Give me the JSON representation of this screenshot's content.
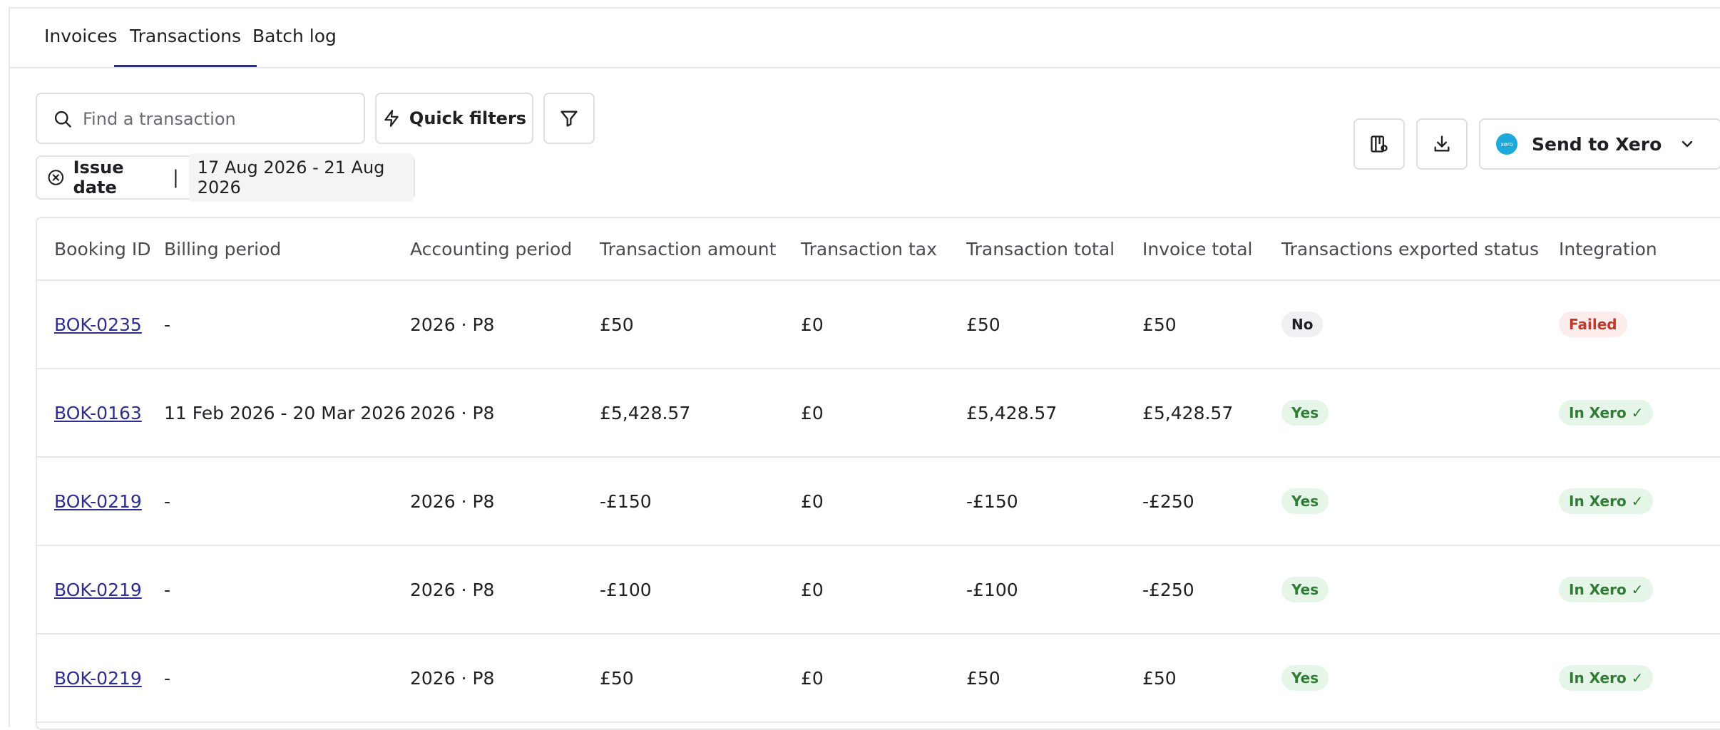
{
  "tabs": [
    {
      "label": "Invoices"
    },
    {
      "label": "Transactions"
    },
    {
      "label": "Batch log"
    }
  ],
  "active_tab": "Transactions",
  "search": {
    "placeholder": "Find a transaction"
  },
  "toolbar": {
    "quick_filters_label": "Quick filters",
    "send_to_xero_label": "Send to Xero",
    "xero_logo_text": "xero"
  },
  "filter_chip": {
    "label": "Issue date",
    "separator": "|",
    "value": "17 Aug 2026 - 21 Aug 2026"
  },
  "table": {
    "headers": [
      "Booking ID",
      "Billing period",
      "Accounting period",
      "Transaction amount",
      "Transaction tax",
      "Transaction total",
      "Invoice total",
      "Transactions exported status",
      "Integration"
    ],
    "rows": [
      {
        "booking_id": "BOK-0235",
        "billing_period": "-",
        "accounting_period": "2026 · P8",
        "amount": "£50",
        "tax": "£0",
        "total": "£50",
        "invoice_total": "£50",
        "exported": "No",
        "integration": "Failed"
      },
      {
        "booking_id": "BOK-0163",
        "billing_period": "11 Feb 2026 - 20 Mar 2026",
        "accounting_period": "2026 · P8",
        "amount": "£5,428.57",
        "tax": "£0",
        "total": "£5,428.57",
        "invoice_total": "£5,428.57",
        "exported": "Yes",
        "integration": "In Xero ✓"
      },
      {
        "booking_id": "BOK-0219",
        "billing_period": "-",
        "accounting_period": "2026 · P8",
        "amount": "-£150",
        "tax": "£0",
        "total": "-£150",
        "invoice_total": "-£250",
        "exported": "Yes",
        "integration": "In Xero ✓"
      },
      {
        "booking_id": "BOK-0219",
        "billing_period": "-",
        "accounting_period": "2026 · P8",
        "amount": "-£100",
        "tax": "£0",
        "total": "-£100",
        "invoice_total": "-£250",
        "exported": "Yes",
        "integration": "In Xero ✓"
      },
      {
        "booking_id": "BOK-0219",
        "billing_period": "-",
        "accounting_period": "2026 · P8",
        "amount": "£50",
        "tax": "£0",
        "total": "£50",
        "invoice_total": "£50",
        "exported": "Yes",
        "integration": "In Xero ✓"
      }
    ]
  },
  "colors": {
    "accent": "#2d2e8f",
    "success_bg": "#e5f5e8",
    "success_text": "#2e7d32",
    "failure_bg": "#fdecec",
    "failure_text": "#c0392b",
    "xero_blue": "#1ea9dc"
  }
}
